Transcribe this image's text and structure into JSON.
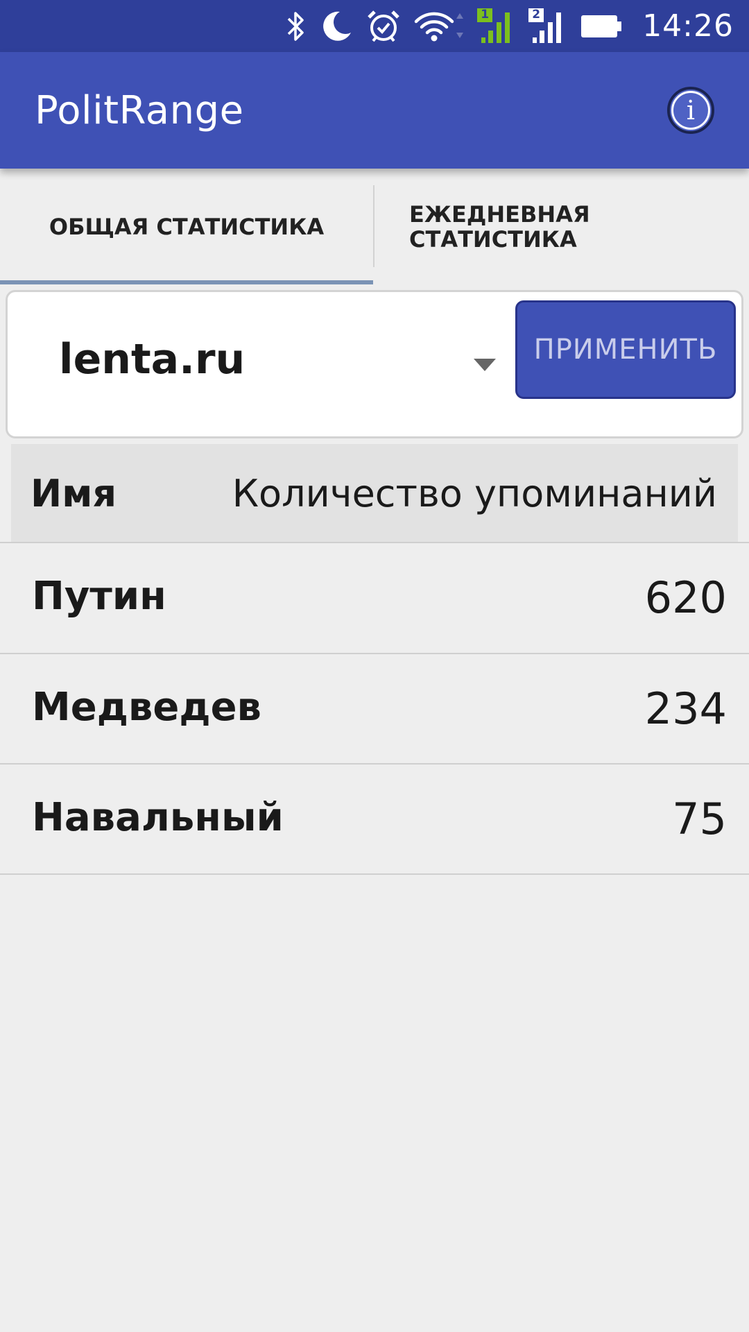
{
  "status_bar": {
    "time": "14:26",
    "icons": [
      "bluetooth-icon",
      "moon-icon",
      "alarm-icon",
      "wifi-icon",
      "signal-sim1-icon",
      "signal-sim2-icon",
      "battery-icon"
    ],
    "sim1_label": "1",
    "sim2_label": "2"
  },
  "app_bar": {
    "title": "PolitRange",
    "info_icon": "info-icon",
    "info_glyph": "i"
  },
  "tabs": [
    {
      "label": "ОБЩАЯ СТАТИСТИКА",
      "selected": true
    },
    {
      "label": "ЕЖЕДНЕВНАЯ СТАТИСТИКА",
      "selected": false
    }
  ],
  "filter": {
    "source_value": "lenta.ru",
    "dropdown_icon": "dropdown-arrow-icon",
    "apply_label": "ПРИМЕНИТЬ"
  },
  "table": {
    "columns": [
      "Имя",
      "Количество упоминаний"
    ],
    "rows": [
      {
        "name": "Путин",
        "count": "620"
      },
      {
        "name": "Медведев",
        "count": "234"
      },
      {
        "name": "Навальный",
        "count": "75"
      }
    ]
  },
  "colors": {
    "status_bar": "#2f3f9a",
    "app_bar": "#3f51b5",
    "tab_indicator": "#7b93b5",
    "background": "#eeeeee",
    "table_header": "#e2e2e2",
    "signal_sim1": "#7cc01e"
  }
}
